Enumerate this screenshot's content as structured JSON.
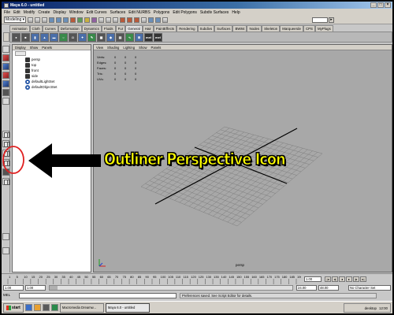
{
  "window": {
    "title": "Maya 6.0 - untitled"
  },
  "menu": [
    "File",
    "Edit",
    "Modify",
    "Create",
    "Display",
    "Window",
    "Edit Curves",
    "Surfaces",
    "Edit NURBS",
    "Polygons",
    "Edit Polygons",
    "Subdiv Surfaces",
    "Help"
  ],
  "status_line": {
    "mode": "Modeling"
  },
  "shelf_tabs": [
    "Animation",
    "Cloth",
    "Curves",
    "Deformation",
    "Dynamics",
    "Fluids",
    "Fur",
    "General",
    "Hair",
    "PaintEffects",
    "Rendering",
    "Subdivs",
    "Surfaces",
    "BW84",
    "Nodes",
    "Skeleton",
    "Marqueerde",
    "CPS",
    "MyPlugs"
  ],
  "shelf_icons": [
    "sphere",
    "cube",
    "cylinder",
    "cone",
    "plane",
    "torus",
    "camera",
    "light",
    "mel",
    "mel"
  ],
  "outliner": {
    "menu": [
      "Display",
      "Show",
      "Panels"
    ],
    "items": [
      {
        "label": "persp",
        "icon": "camera-icon"
      },
      {
        "label": "top",
        "icon": "camera-icon"
      },
      {
        "label": "front",
        "icon": "camera-icon"
      },
      {
        "label": "side",
        "icon": "camera-icon"
      },
      {
        "label": "defaultLightSet",
        "icon": "set-icon"
      },
      {
        "label": "defaultObjectSet",
        "icon": "set-icon"
      }
    ]
  },
  "viewport": {
    "menu": [
      "View",
      "Shading",
      "Lighting",
      "Show",
      "Panels"
    ],
    "hud": [
      {
        "label": "Verts:",
        "values": [
          "0",
          "0",
          "0"
        ]
      },
      {
        "label": "Edges:",
        "values": [
          "0",
          "0",
          "0"
        ]
      },
      {
        "label": "Faces:",
        "values": [
          "0",
          "0",
          "0"
        ]
      },
      {
        "label": "Tris:",
        "values": [
          "0",
          "0",
          "0"
        ]
      },
      {
        "label": "UVs:",
        "values": [
          "0",
          "0",
          "0"
        ]
      }
    ],
    "camera_label": "persp"
  },
  "timeline": {
    "ticks": [
      "1",
      "5",
      "10",
      "15",
      "20",
      "25",
      "30",
      "35",
      "40",
      "45",
      "50",
      "55",
      "60",
      "65",
      "70",
      "75",
      "80",
      "85",
      "90",
      "95",
      "100",
      "105",
      "110",
      "115",
      "120",
      "125",
      "130",
      "135",
      "140",
      "145",
      "150",
      "155",
      "160",
      "165",
      "170",
      "175",
      "180",
      "185",
      "190"
    ],
    "current_frame": "1.00"
  },
  "range": {
    "start": "1.00",
    "inner_start": "1.00",
    "inner_end": "24.00",
    "end": "48.00",
    "character_set": "No Character Set"
  },
  "command_line": {
    "label": "MEL",
    "result": "Preferences saved. See Script Editor for details."
  },
  "taskbar": {
    "start": "start",
    "tasks": [
      "Macromedia Dreamw...",
      "Maya 6.0 - untitled"
    ],
    "desktop_label": "desktop",
    "clock": "12:00"
  },
  "annotation": {
    "text": "Outliner Perspective Icon",
    "color": "#ffff00"
  },
  "colors": {
    "viewport_bg": "#a8a8a8",
    "annotation_arrow": "#000000",
    "annotation_circle": "#e02020"
  }
}
